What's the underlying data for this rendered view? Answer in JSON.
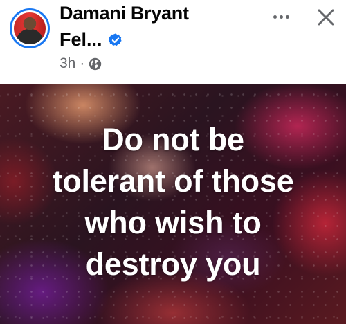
{
  "post": {
    "author_name": "Damani Bryant",
    "author_subname": "Fel...",
    "time": "3h",
    "separator": "·",
    "privacy_icon": "globe-icon",
    "verified_icon": "verified-badge-icon",
    "more_icon": "more-options-icon",
    "close_icon": "close-icon",
    "text_lines": [
      "Do not be",
      "tolerant of those",
      "who wish to",
      "destroy you"
    ],
    "colors": {
      "verified": "#1877f2",
      "avatar_ring": "#1877f2",
      "text_primary": "#050505",
      "text_secondary": "#65676b"
    }
  }
}
